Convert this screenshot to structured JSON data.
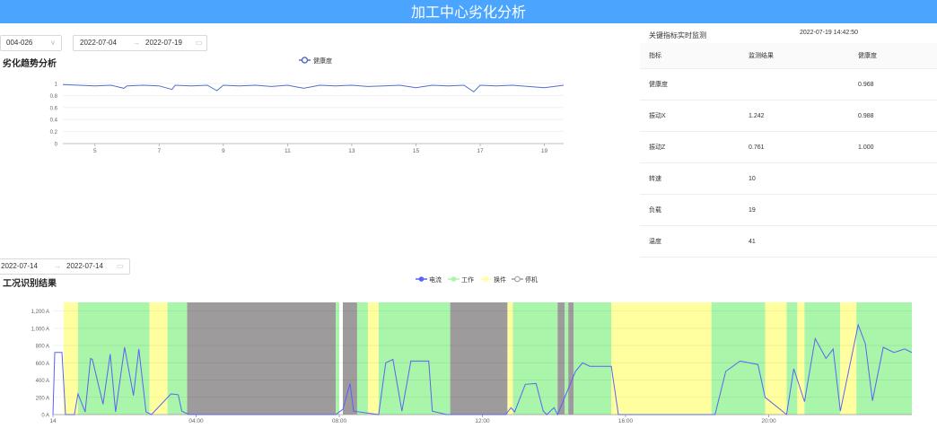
{
  "header": {
    "title": "加工中心劣化分析"
  },
  "controls": {
    "device_select": "004-026",
    "range1": {
      "start": "2022-07-04",
      "end": "2022-07-19"
    },
    "range2": {
      "start": "2022-07-14",
      "end": "2022-07-14"
    }
  },
  "trend": {
    "heading": "劣化趋势分析",
    "legend": "健康度"
  },
  "monitor": {
    "title": "关键指标实时监测",
    "time": "2022-07-19 14:42:50",
    "columns": [
      "指标",
      "监测结果",
      "健康度"
    ],
    "rows": [
      [
        "健康度",
        "",
        "0.968"
      ],
      [
        "振动X",
        "1.242",
        "0.988"
      ],
      [
        "振动Z",
        "0.761",
        "1.000"
      ],
      [
        "转速",
        "10",
        ""
      ],
      [
        "负载",
        "19",
        ""
      ],
      [
        "温度",
        "41",
        ""
      ]
    ]
  },
  "condition": {
    "heading": "工况识别结果",
    "legend": [
      "电流",
      "工作",
      "换件",
      "停机"
    ]
  },
  "colors": {
    "accent": "#4ba5ff",
    "line": "#5470c6",
    "current": "#5b62f7",
    "work": "#a9f5a9",
    "swap": "#ffff9f",
    "stop": "#9d9b9b"
  },
  "chart_data": [
    {
      "type": "line",
      "title": "劣化趋势分析",
      "x_ticks": [
        "5",
        "7",
        "9",
        "11",
        "13",
        "15",
        "17",
        "19"
      ],
      "y_ticks": [
        "0",
        "0.2",
        "0.4",
        "0.6",
        "0.8",
        "1"
      ],
      "xlim": [
        4,
        19.6
      ],
      "ylim": [
        0,
        1
      ],
      "series": [
        {
          "name": "健康度",
          "x": [
            4,
            4.5,
            5,
            5.5,
            5.9,
            6,
            6.5,
            7,
            7.4,
            7.5,
            8,
            8.5,
            8.8,
            9,
            9.5,
            10,
            10.5,
            11,
            11.5,
            12,
            12.5,
            13,
            13.5,
            14,
            14.5,
            15,
            15.5,
            16,
            16.5,
            16.8,
            17,
            17.5,
            18,
            18.5,
            19,
            19.6
          ],
          "values": [
            0.98,
            0.97,
            0.96,
            0.97,
            0.92,
            0.96,
            0.97,
            0.96,
            0.9,
            0.97,
            0.96,
            0.97,
            0.88,
            0.97,
            0.96,
            0.97,
            0.95,
            0.97,
            0.92,
            0.97,
            0.96,
            0.97,
            0.95,
            0.96,
            0.97,
            0.93,
            0.97,
            0.96,
            0.97,
            0.86,
            0.97,
            0.96,
            0.97,
            0.95,
            0.93,
            0.97
          ]
        }
      ]
    },
    {
      "type": "area",
      "title": "工况识别结果",
      "x_ticks": [
        "14",
        "04:00",
        "08:00",
        "12:00",
        "16:00",
        "20:00"
      ],
      "y_ticks": [
        "0 A",
        "200 A",
        "400 A",
        "600 A",
        "800 A",
        "1,000 A",
        "1,200 A"
      ],
      "xlim": [
        0,
        24
      ],
      "ylim": [
        0,
        1300
      ],
      "states": [
        {
          "state": "换件",
          "from": 0.3,
          "to": 0.7
        },
        {
          "state": "工作",
          "from": 0.7,
          "to": 2.7
        },
        {
          "state": "换件",
          "from": 2.7,
          "to": 3.2
        },
        {
          "state": "工作",
          "from": 3.2,
          "to": 3.75
        },
        {
          "state": "停机",
          "from": 3.75,
          "to": 7.9
        },
        {
          "state": "工作",
          "from": 7.9,
          "to": 8.0
        },
        {
          "state": "停机",
          "from": 8.1,
          "to": 8.5
        },
        {
          "state": "工作",
          "from": 8.5,
          "to": 8.8
        },
        {
          "state": "换件",
          "from": 8.8,
          "to": 9.1
        },
        {
          "state": "工作",
          "from": 9.1,
          "to": 11.1
        },
        {
          "state": "停机",
          "from": 11.1,
          "to": 12.7
        },
        {
          "state": "换件",
          "from": 12.7,
          "to": 12.85
        },
        {
          "state": "工作",
          "from": 12.85,
          "to": 14.1
        },
        {
          "state": "停机",
          "from": 14.1,
          "to": 14.3
        },
        {
          "state": "工作",
          "from": 14.3,
          "to": 14.4
        },
        {
          "state": "停机",
          "from": 14.4,
          "to": 14.55
        },
        {
          "state": "工作",
          "from": 14.55,
          "to": 15.6
        },
        {
          "state": "换件",
          "from": 15.6,
          "to": 18.4
        },
        {
          "state": "工作",
          "from": 18.4,
          "to": 19.9
        },
        {
          "state": "换件",
          "from": 19.9,
          "to": 20.5
        },
        {
          "state": "工作",
          "from": 20.5,
          "to": 20.8
        },
        {
          "state": "换件",
          "from": 20.8,
          "to": 21.0
        },
        {
          "state": "工作",
          "from": 21.0,
          "to": 22.0
        },
        {
          "state": "换件",
          "from": 22.0,
          "to": 22.45
        },
        {
          "state": "工作",
          "from": 22.45,
          "to": 24.0
        }
      ],
      "series": [
        {
          "name": "电流",
          "x": [
            0,
            0.05,
            0.1,
            0.25,
            0.35,
            0.6,
            0.7,
            0.9,
            1.05,
            1.1,
            1.4,
            1.6,
            1.75,
            2.0,
            2.25,
            2.4,
            2.6,
            2.75,
            3.3,
            3.5,
            3.6,
            3.8,
            7.9,
            8.1,
            8.3,
            8.4,
            9.1,
            9.3,
            9.5,
            9.75,
            10.0,
            10.5,
            10.6,
            11.0,
            11.1,
            12.65,
            12.8,
            12.9,
            13.2,
            13.5,
            13.7,
            13.8,
            14.0,
            14.1,
            14.6,
            14.8,
            15.0,
            15.6,
            15.8,
            18.4,
            18.5,
            18.8,
            19.2,
            19.7,
            19.9,
            20.5,
            20.7,
            21.0,
            21.3,
            21.6,
            21.8,
            22.0,
            22.5,
            22.7,
            22.9,
            23.2,
            23.5,
            23.8,
            24.0
          ],
          "values": [
            0,
            720,
            720,
            720,
            0,
            0,
            240,
            30,
            650,
            640,
            120,
            700,
            30,
            780,
            220,
            760,
            30,
            0,
            240,
            230,
            40,
            0,
            0,
            60,
            360,
            40,
            0,
            600,
            640,
            40,
            620,
            620,
            40,
            0,
            0,
            0,
            80,
            30,
            350,
            360,
            40,
            0,
            80,
            0,
            500,
            600,
            560,
            560,
            0,
            0,
            0,
            500,
            620,
            580,
            200,
            0,
            530,
            150,
            880,
            650,
            760,
            40,
            1040,
            820,
            160,
            780,
            720,
            760,
            720
          ]
        }
      ]
    }
  ]
}
